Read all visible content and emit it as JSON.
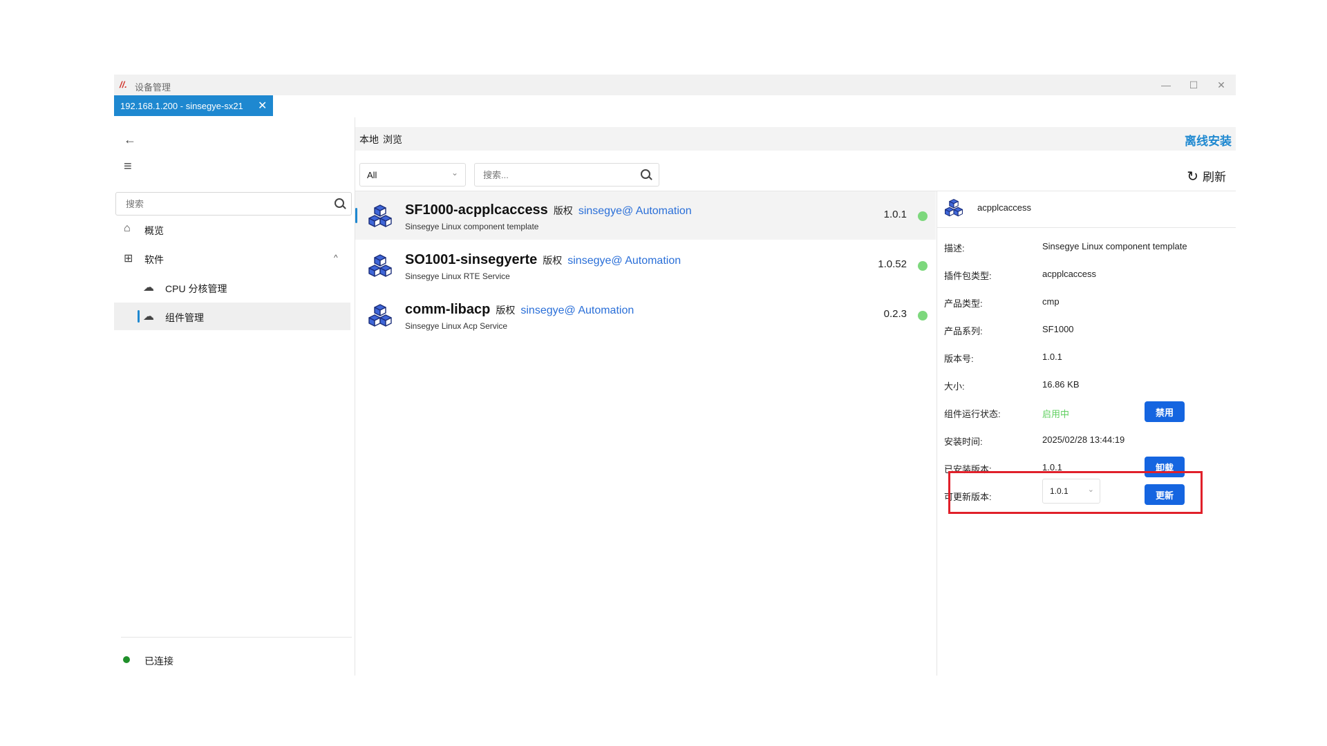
{
  "window": {
    "logo": "//.",
    "title": "设备管理",
    "controls": {
      "minimize": "—",
      "maximize": "☐",
      "close": "✕"
    }
  },
  "tab": {
    "label": "192.168.1.200 - sinsegye-sx21",
    "close": "✕"
  },
  "sidebar": {
    "back_icon": "←",
    "menu_icon": "≡",
    "search_placeholder": "搜索",
    "items": [
      {
        "label": "概览",
        "icon": "⌂"
      },
      {
        "label": "软件",
        "icon": "⊞",
        "chevron": "^"
      },
      {
        "label": "CPU 分核管理",
        "icon": "☁"
      },
      {
        "label": "组件管理",
        "icon": "☁"
      }
    ],
    "status": "已连接"
  },
  "main": {
    "tabs": [
      "本地",
      "浏览"
    ],
    "offline_install": "离线安装",
    "filter": {
      "value": "All",
      "chevron": "⌄"
    },
    "search_placeholder": "搜索...",
    "refresh": {
      "icon": "↻",
      "label": "刷新"
    }
  },
  "packages": [
    {
      "name": "SF1000-acpplcaccess",
      "copyright": "版权",
      "vendor": "sinsegye@ Automation",
      "description": "Sinsegye Linux component template",
      "version": "1.0.1",
      "status_color": "#7dd87d"
    },
    {
      "name": "SO1001-sinsegyerte",
      "copyright": "版权",
      "vendor": "sinsegye@ Automation",
      "description": "Sinsegye Linux RTE Service",
      "version": "1.0.52",
      "status_color": "#7dd87d"
    },
    {
      "name": "comm-libacp",
      "copyright": "版权",
      "vendor": "sinsegye@ Automation",
      "description": "Sinsegye Linux Acp Service",
      "version": "0.2.3",
      "status_color": "#7dd87d"
    }
  ],
  "detail": {
    "title": "acpplcaccess",
    "fields": [
      {
        "label": "描述:",
        "value": "Sinsegye Linux component template"
      },
      {
        "label": "插件包类型:",
        "value": "acpplcaccess"
      },
      {
        "label": "产品类型:",
        "value": "cmp"
      },
      {
        "label": "产品系列:",
        "value": "SF1000"
      },
      {
        "label": "版本号:",
        "value": "1.0.1"
      },
      {
        "label": "大小:",
        "value": "16.86 KB"
      },
      {
        "label": "组件运行状态:",
        "value": "启用中",
        "button": "禁用"
      },
      {
        "label": "安装时间:",
        "value": "2025/02/28 13:44:19"
      },
      {
        "label": "已安装版本:",
        "value": "1.0.1",
        "button": "卸载"
      },
      {
        "label": "可更新版本:",
        "value": "1.0.1",
        "button": "更新"
      }
    ],
    "select_chevron": "⌄"
  }
}
